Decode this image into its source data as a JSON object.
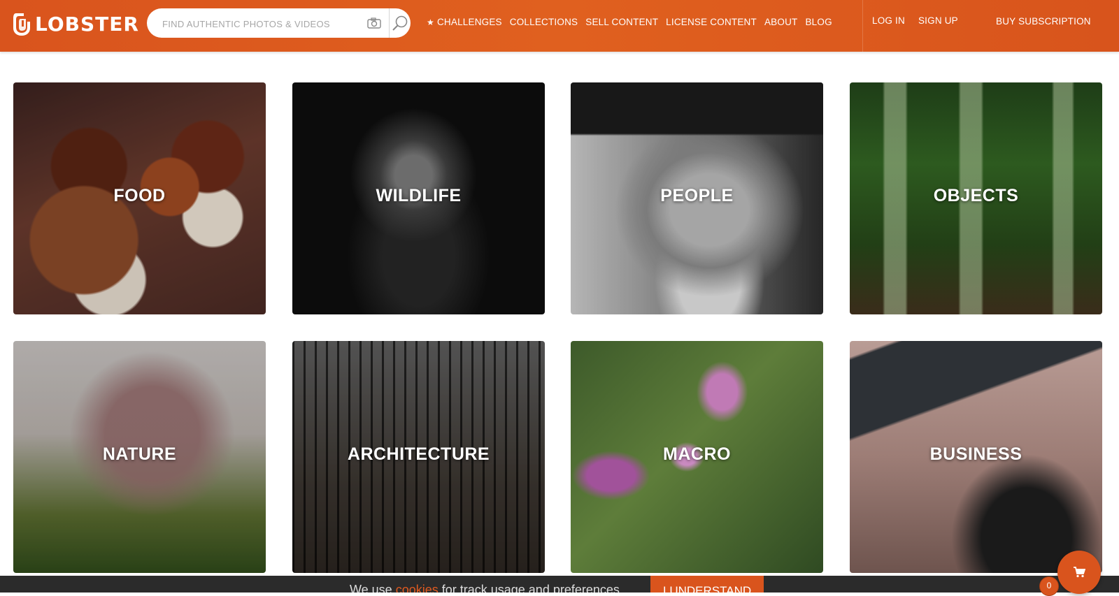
{
  "brand": {
    "name": "LOBSTER",
    "accent_color": "#d9541d"
  },
  "search": {
    "placeholder": "FIND AUTHENTIC PHOTOS & VIDEOS",
    "camera_icon": "camera-icon",
    "search_icon": "magnifier-icon"
  },
  "nav": {
    "items": [
      {
        "label": "CHALLENGES",
        "icon": "star-icon"
      },
      {
        "label": "COLLECTIONS"
      },
      {
        "label": "SELL CONTENT"
      },
      {
        "label": "LICENSE CONTENT"
      },
      {
        "label": "ABOUT"
      },
      {
        "label": "BLOG"
      }
    ]
  },
  "auth": {
    "login": "LOG IN",
    "signup": "SIGN UP"
  },
  "subscription": {
    "label": "BUY SUBSCRIPTION"
  },
  "categories": [
    {
      "label": "FOOD"
    },
    {
      "label": "WILDLIFE"
    },
    {
      "label": "PEOPLE"
    },
    {
      "label": "OBJECTS"
    },
    {
      "label": "NATURE"
    },
    {
      "label": "ARCHITECTURE"
    },
    {
      "label": "MACRO"
    },
    {
      "label": "BUSINESS"
    }
  ],
  "cookie_bar": {
    "text_before": "We use ",
    "link": "cookies",
    "text_after": " for track usage and preferences",
    "button": "I UNDERSTAND"
  },
  "cart": {
    "count": "0",
    "icon": "cart-icon"
  }
}
